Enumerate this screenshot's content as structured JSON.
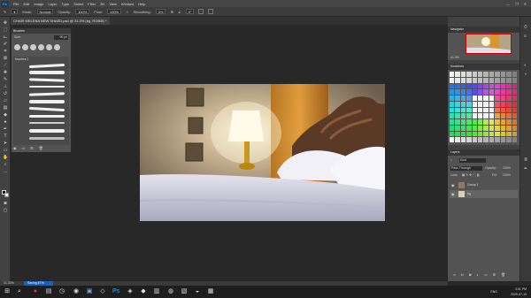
{
  "menubar": {
    "app_icon": "Ps",
    "items": [
      "File",
      "Edit",
      "Image",
      "Layer",
      "Type",
      "Select",
      "Filter",
      "3D",
      "View",
      "Window",
      "Help"
    ],
    "window_controls": [
      "—",
      "❐",
      "✕"
    ]
  },
  "options": {
    "mode_label": "Mode:",
    "mode_value": "Normal",
    "opacity_label": "Opacity:",
    "opacity_value": "100%",
    "flow_label": "Flow:",
    "flow_value": "100%",
    "smoothing_label": "Smoothing:",
    "smoothing_value": "0%",
    "angle_value": "0°"
  },
  "document": {
    "tab_title": "CHAIR MELENA NEW SHAED.psd @ 31.3% (bg, RGB/8) *  ✕",
    "status_zoom": "31.33%",
    "status_progress": "Saving 87%"
  },
  "brush_panel": {
    "title": "Brushes",
    "size_label": "Size:",
    "size_value": "90 px",
    "folder_label": "brushes 1"
  },
  "navigator": {
    "title": "Navigator",
    "zoom": "31.3%"
  },
  "swatches": {
    "title": "Swatches"
  },
  "layers": {
    "title": "Layers",
    "kind_label": "Kind",
    "blend_mode": "Pass Through",
    "opacity_label": "Opacity:",
    "opacity_value": "100%",
    "lock_label": "Lock:",
    "fill_label": "Fill:",
    "fill_value": "100%",
    "items": [
      {
        "name": "Group 1",
        "visible": true
      },
      {
        "name": "bg",
        "visible": true
      }
    ]
  },
  "taskbar": {
    "time": "3:01 PM",
    "date": "2020-07-13",
    "language": "ENG"
  },
  "colors": {
    "menubar_bg": "#454545",
    "panel_bg": "#535353",
    "workspace_bg": "#282828",
    "progress": "#1f5fb5"
  }
}
